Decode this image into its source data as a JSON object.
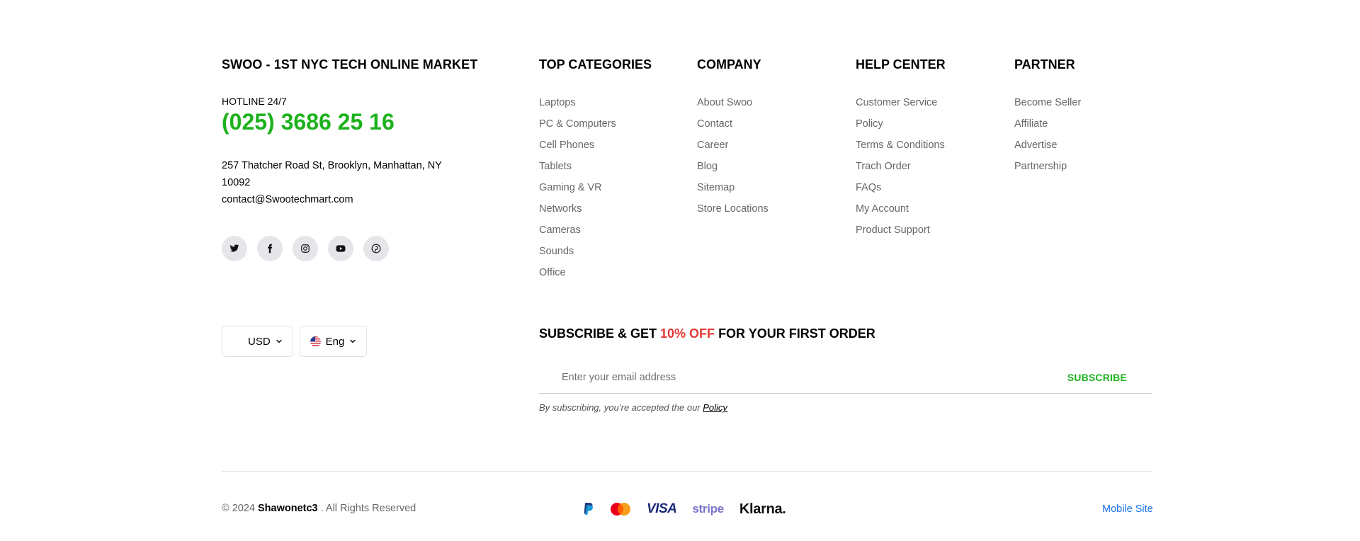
{
  "brand": {
    "title": "SWOO - 1ST NYC TECH ONLINE MARKET",
    "hotline_label": "HOTLINE 24/7",
    "hotline_number": "(025) 3686 25 16",
    "address": "257 Thatcher Road St, Brooklyn, Manhattan, NY 10092",
    "email": "contact@Swootechmart.com",
    "accent_color": "#1db21d"
  },
  "socials": [
    "twitter-icon",
    "facebook-icon",
    "instagram-icon",
    "youtube-icon",
    "pinterest-icon"
  ],
  "columns": {
    "top_categories": {
      "title": "TOP CATEGORIES",
      "items": [
        "Laptops",
        "PC & Computers",
        "Cell Phones",
        "Tablets",
        "Gaming & VR",
        "Networks",
        "Cameras",
        "Sounds",
        "Office"
      ]
    },
    "company": {
      "title": "COMPANY",
      "items": [
        "About Swoo",
        "Contact",
        "Career",
        "Blog",
        "Sitemap",
        "Store Locations"
      ]
    },
    "help_center": {
      "title": "HELP CENTER",
      "items": [
        "Customer Service",
        "Policy",
        "Terms & Conditions",
        "Trach Order",
        "FAQs",
        "My Account",
        "Product Support"
      ]
    },
    "partner": {
      "title": "PARTNER",
      "items": [
        "Become Seller",
        "Affiliate",
        "Advertise",
        "Partnership"
      ]
    }
  },
  "selectors": {
    "currency": "USD",
    "language": "Eng"
  },
  "subscribe": {
    "title_prefix": "SUBSCRIBE & GET ",
    "title_accent": "10% OFF",
    "title_suffix": " FOR YOUR FIRST ORDER",
    "placeholder": "Enter your email address",
    "button": "SUBSCRIBE",
    "note": "By subscribing, you’re accepted the our ",
    "note_link": "Policy",
    "accent_color": "#e53935"
  },
  "footer": {
    "copyright_prefix": "© 2024 ",
    "copyright_name": "Shawonetc3",
    "copyright_suffix": " . All Rights Reserved",
    "payments": [
      "paypal-icon",
      "mastercard-icon",
      "visa-icon",
      "stripe-icon",
      "klarna-icon"
    ],
    "visa_text": "VISA",
    "stripe_text": "stripe",
    "klarna_text": "Klarna.",
    "mobile_site": "Mobile Site"
  }
}
